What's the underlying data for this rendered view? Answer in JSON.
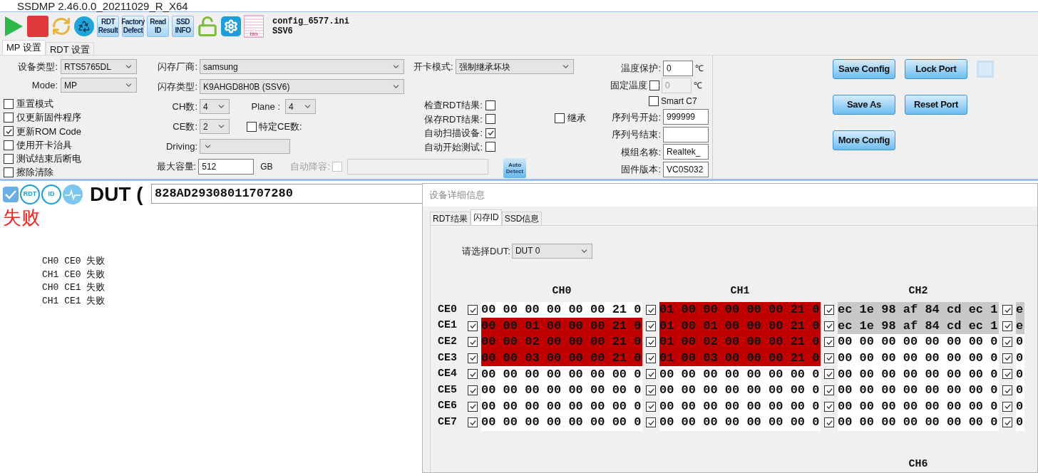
{
  "window": {
    "title": "SSDMP 2.46.0.0_20211029_R_X64"
  },
  "toolbar": {
    "buttons": [
      {
        "kind": "play"
      },
      {
        "kind": "stop"
      },
      {
        "kind": "refresh"
      },
      {
        "kind": "recycle"
      },
      {
        "kind": "text",
        "lines": [
          "RDT",
          "Result"
        ]
      },
      {
        "kind": "text",
        "lines": [
          "Factory",
          "Defect"
        ]
      },
      {
        "kind": "text",
        "lines": [
          "Read",
          "ID"
        ]
      },
      {
        "kind": "text",
        "lines": [
          "SSD",
          "INFO"
        ]
      },
      {
        "kind": "lock"
      },
      {
        "kind": "gear"
      },
      {
        "kind": "file",
        "lines": [
          "bin"
        ]
      }
    ],
    "config": [
      "config_6577.ini",
      "SSV6"
    ]
  },
  "tabs": [
    {
      "label": "MP 设置",
      "selected": true
    },
    {
      "label": "RDT 设置",
      "selected": false
    }
  ],
  "settings": {
    "device_type": {
      "label": "设备类型:",
      "value": "RTS5765DL"
    },
    "mode": {
      "label": "Mode:",
      "value": "MP"
    },
    "options": [
      {
        "label": "重置模式",
        "checked": false
      },
      {
        "label": "仅更新固件程序",
        "checked": false
      },
      {
        "label": "更新ROM Code",
        "checked": true
      },
      {
        "label": "使用开卡治具",
        "checked": false
      },
      {
        "label": "测试结束后断电",
        "checked": false
      },
      {
        "label": "擦除清除",
        "checked": false
      }
    ],
    "flash_vendor": {
      "label": "闪存厂商:",
      "value": "samsung"
    },
    "flash_type": {
      "label": "闪存类型:",
      "value": "K9AHGD8H0B (SSV6)"
    },
    "ch_count": {
      "label": "CH数:",
      "value": "4"
    },
    "plane": {
      "label": "Plane :",
      "value": "4"
    },
    "ce_count": {
      "label": "CE数:",
      "value": "2"
    },
    "specific_ce": {
      "label": "特定CE数:",
      "checked": false
    },
    "driving": {
      "label": "Driving:"
    },
    "max_capacity": {
      "label": "最大容量:",
      "value": "512",
      "unit": "GB"
    },
    "auto_derate": {
      "label": "自动降容:",
      "checked": false
    },
    "card_mode": {
      "label": "开卡模式:",
      "value": "强制继承坏块"
    },
    "checks": [
      {
        "label": "检查RDT结果:",
        "checked": false
      },
      {
        "label": "保存RDT结果:",
        "checked": false
      },
      {
        "label": "自动扫描设备:",
        "checked": true
      },
      {
        "label": "自动开始测试:",
        "checked": false
      }
    ],
    "inherit": {
      "label": "继承",
      "checked": false
    },
    "auto_detect": [
      "Auto",
      "Detect"
    ],
    "temp_protect": {
      "label": "温度保护:",
      "value": "0",
      "unit": "℃"
    },
    "fixed_temp": {
      "label": "固定温度",
      "checked": false,
      "value": "0",
      "unit": "℃"
    },
    "smart_c7": {
      "label": "Smart C7",
      "checked": false
    },
    "fields": [
      {
        "label": "序列号开始:",
        "value": "999999"
      },
      {
        "label": "序列号结束:"
      },
      {
        "label": "模组名称:",
        "value": "Realtek_"
      },
      {
        "label": "固件版本:",
        "value": "VC0S032"
      }
    ]
  },
  "actions": [
    [
      {
        "label": "Save Config"
      },
      {
        "label": "Lock Port"
      }
    ],
    [
      {
        "label": "Save As"
      },
      {
        "label": "Reset Port"
      }
    ],
    [
      {
        "label": "More Config"
      }
    ]
  ],
  "dut": {
    "checked": true,
    "badges": [
      "RDT",
      "ID"
    ],
    "title": "DUT (",
    "serial": "828AD29308011707280",
    "result": "失败",
    "log": [
      "CH0 CE0 失败",
      "CH1 CE0 失败",
      "CH0 CE1 失败",
      "CH1 CE1 失败"
    ]
  },
  "dialog": {
    "title": "设备详细信息",
    "tabs": [
      {
        "label": "RDT结果",
        "selected": false
      },
      {
        "label": "闪存ID",
        "selected": true
      },
      {
        "label": "SSD信息",
        "selected": false
      }
    ],
    "dut_select": {
      "label": "请选择DUT:",
      "value": "DUT 0"
    },
    "channels": [
      "CH0",
      "CH1",
      "CH2"
    ],
    "rows": [
      {
        "label": "CE0",
        "cells": [
          {
            "checked": true,
            "text": "00 00 00 00 00 00 21 0",
            "color": "#ffffff"
          },
          {
            "checked": true,
            "text": "01 00 00 00 00 00 21 0",
            "color": "#c00000"
          },
          {
            "checked": true,
            "text": "ec 1e 98 af 84 cd ec 1",
            "color": "#c8c8c8"
          },
          {
            "checked": true,
            "text": "e",
            "color": "#c8c8c8"
          }
        ]
      },
      {
        "label": "CE1",
        "cells": [
          {
            "checked": true,
            "text": "00 00 01 00 00 00 21 0",
            "color": "#c00000"
          },
          {
            "checked": true,
            "text": "01 00 01 00 00 00 21 0",
            "color": "#c00000"
          },
          {
            "checked": true,
            "text": "ec 1e 98 af 84 cd ec 1",
            "color": "#c8c8c8"
          },
          {
            "checked": true,
            "text": "e",
            "color": "#c8c8c8"
          }
        ]
      },
      {
        "label": "CE2",
        "cells": [
          {
            "checked": true,
            "text": "00 00 02 00 00 00 21 0",
            "color": "#c00000"
          },
          {
            "checked": true,
            "text": "01 00 02 00 00 00 21 0",
            "color": "#c00000"
          },
          {
            "checked": true,
            "text": "00 00 00 00 00 00 00 0",
            "color": "#ffffff"
          },
          {
            "checked": true,
            "text": "0",
            "color": "#ffffff"
          }
        ]
      },
      {
        "label": "CE3",
        "cells": [
          {
            "checked": true,
            "text": "00 00 03 00 00 00 21 0",
            "color": "#c00000"
          },
          {
            "checked": true,
            "text": "01 00 03 00 00 00 21 0",
            "color": "#c00000"
          },
          {
            "checked": true,
            "text": "00 00 00 00 00 00 00 0",
            "color": "#ffffff"
          },
          {
            "checked": true,
            "text": "0",
            "color": "#ffffff"
          }
        ]
      },
      {
        "label": "CE4",
        "cells": [
          {
            "checked": true,
            "text": "00 00 00 00 00 00 00 0",
            "color": "#ffffff"
          },
          {
            "checked": true,
            "text": "00 00 00 00 00 00 00 0",
            "color": "#ffffff"
          },
          {
            "checked": true,
            "text": "00 00 00 00 00 00 00 0",
            "color": "#ffffff"
          },
          {
            "checked": true,
            "text": "0",
            "color": "#ffffff"
          }
        ]
      },
      {
        "label": "CE5",
        "cells": [
          {
            "checked": true,
            "text": "00 00 00 00 00 00 00 0",
            "color": "#ffffff"
          },
          {
            "checked": true,
            "text": "00 00 00 00 00 00 00 0",
            "color": "#ffffff"
          },
          {
            "checked": true,
            "text": "00 00 00 00 00 00 00 0",
            "color": "#ffffff"
          },
          {
            "checked": true,
            "text": "0",
            "color": "#ffffff"
          }
        ]
      },
      {
        "label": "CE6",
        "cells": [
          {
            "checked": true,
            "text": "00 00 00 00 00 00 00 0",
            "color": "#ffffff"
          },
          {
            "checked": true,
            "text": "00 00 00 00 00 00 00 0",
            "color": "#ffffff"
          },
          {
            "checked": true,
            "text": "00 00 00 00 00 00 00 0",
            "color": "#ffffff"
          },
          {
            "checked": true,
            "text": "0",
            "color": "#ffffff"
          }
        ]
      },
      {
        "label": "CE7",
        "cells": [
          {
            "checked": true,
            "text": "00 00 00 00 00 00 00 0",
            "color": "#ffffff"
          },
          {
            "checked": true,
            "text": "00 00 00 00 00 00 00 0",
            "color": "#ffffff"
          },
          {
            "checked": true,
            "text": "00 00 00 00 00 00 00 0",
            "color": "#ffffff"
          },
          {
            "checked": true,
            "text": "0",
            "color": "#ffffff"
          }
        ]
      }
    ],
    "next_channels": [
      "CH6"
    ]
  }
}
